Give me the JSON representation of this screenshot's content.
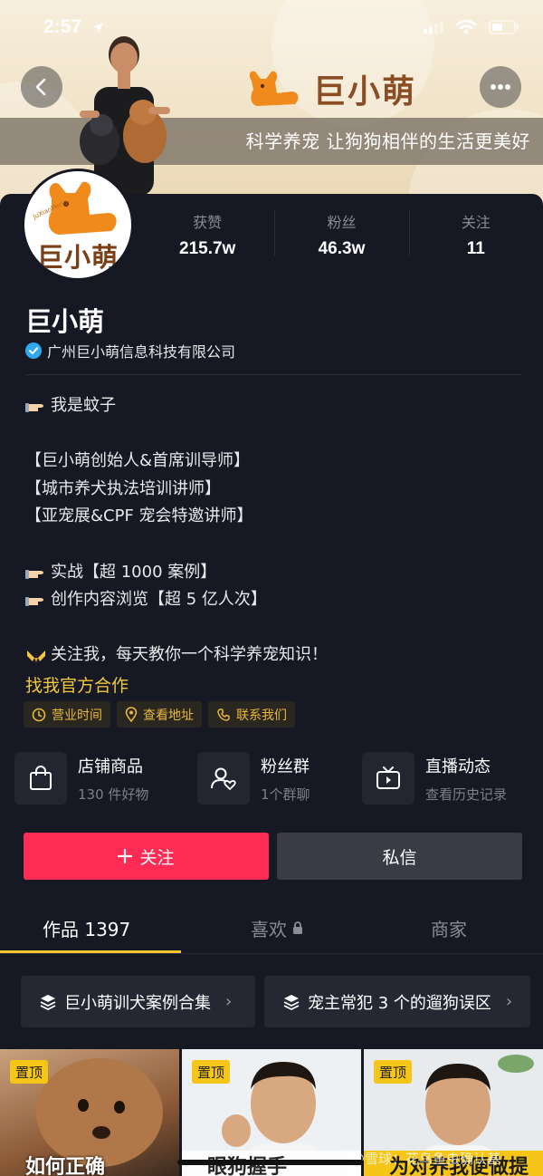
{
  "status_bar": {
    "time": "2:57"
  },
  "banner": {
    "brand_name": "巨小萌",
    "brand_small": "JuXiaoMeng",
    "slogan": "科学养宠 让狗狗相伴的生活更美好"
  },
  "profile": {
    "avatar_text": "巨小萌",
    "avatar_small": "JuXiaoMeng",
    "name": "巨小萌",
    "verification": "广州巨小萌信息科技有限公司",
    "stats": [
      {
        "label": "获赞",
        "value": "215.7w"
      },
      {
        "label": "粉丝",
        "value": "46.3w"
      },
      {
        "label": "关注",
        "value": "11"
      }
    ]
  },
  "bio": {
    "line1": "我是蚊子",
    "line2": "【巨小萌创始人&首席训导师】",
    "line3": "【城市养犬执法培训讲师】",
    "line4": "【亚宠展&CPF 宠会特邀讲师】",
    "line5": "实战【超 1000 案例】",
    "line6": "创作内容浏览【超 5 亿人次】",
    "line7": "关注我，每天教你一个科学养宠知识！"
  },
  "cta_link": "找我官方合作",
  "chips": [
    {
      "label": "营业时间",
      "icon": "clock-icon"
    },
    {
      "label": "查看地址",
      "icon": "location-pin-icon"
    },
    {
      "label": "联系我们",
      "icon": "phone-icon"
    }
  ],
  "features": [
    {
      "title": "店铺商品",
      "subtitle": "130 件好物",
      "icon": "shopping-bag-icon"
    },
    {
      "title": "粉丝群",
      "subtitle": "1个群聊",
      "icon": "fan-group-icon"
    },
    {
      "title": "直播动态",
      "subtitle": "查看历史记录",
      "icon": "live-tv-icon"
    }
  ],
  "actions": {
    "follow": "关注",
    "message": "私信"
  },
  "tabs": [
    {
      "label": "作品 1397",
      "active": true
    },
    {
      "label": "喜欢",
      "active": false,
      "locked": true
    },
    {
      "label": "商家",
      "active": false
    }
  ],
  "collections": [
    {
      "label": "巨小萌训犬案例合集"
    },
    {
      "label": "宠主常犯 3 个的遛狗误区"
    }
  ],
  "videos": [
    {
      "pinned": "置顶",
      "caption": "如何正确"
    },
    {
      "pinned": "置顶",
      "caption": "眼狗握手"
    },
    {
      "pinned": "置顶",
      "caption": "为对养我便做提"
    }
  ],
  "watermark": "@雪球：花鸟鱼虫确认基",
  "colors": {
    "accent": "#fe2c55",
    "highlight": "#f7c531",
    "background": "#161823",
    "brand_orange": "#f08a1c"
  }
}
